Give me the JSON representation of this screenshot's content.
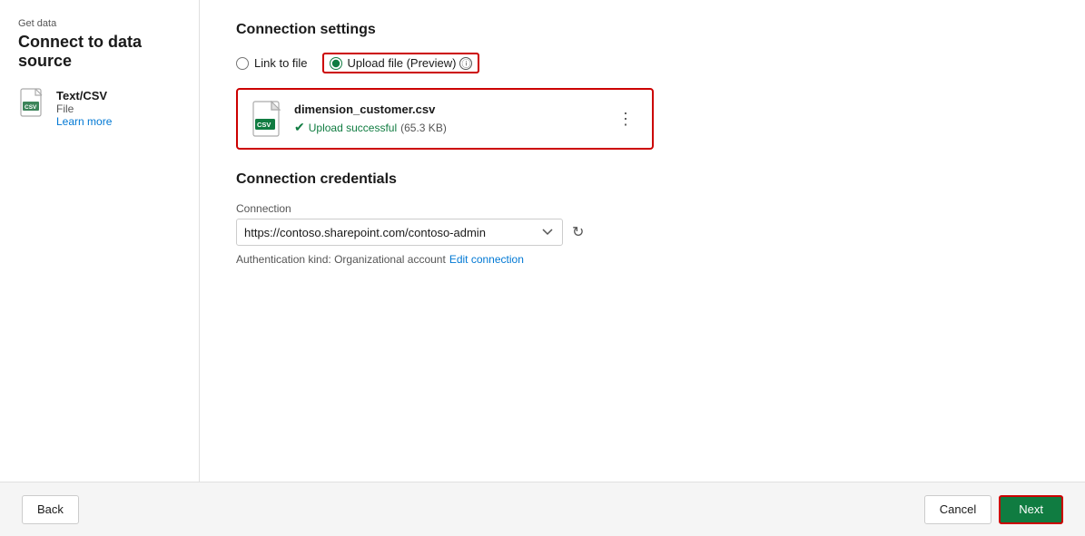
{
  "breadcrumb": "Get data",
  "page_title": "Connect to data source",
  "sidebar": {
    "icon_alt": "csv-file",
    "item_name": "Text/CSV",
    "item_type": "File",
    "learn_more_label": "Learn more"
  },
  "connection_settings": {
    "section_title": "Connection settings",
    "radio_link": "Link to file",
    "radio_upload": "Upload file (Preview)",
    "info_icon_label": "ⓘ",
    "file": {
      "name": "dimension_customer.csv",
      "status_text": "Upload successful",
      "status_size": "(65.3 KB)"
    },
    "menu_dots": "⋮"
  },
  "credentials": {
    "section_title": "Connection credentials",
    "field_label": "Connection",
    "connection_value": "https://contoso.sharepoint.com/contoso-admin",
    "auth_label": "Authentication kind: Organizational account",
    "edit_link": "Edit connection"
  },
  "footer": {
    "back_label": "Back",
    "cancel_label": "Cancel",
    "next_label": "Next"
  }
}
